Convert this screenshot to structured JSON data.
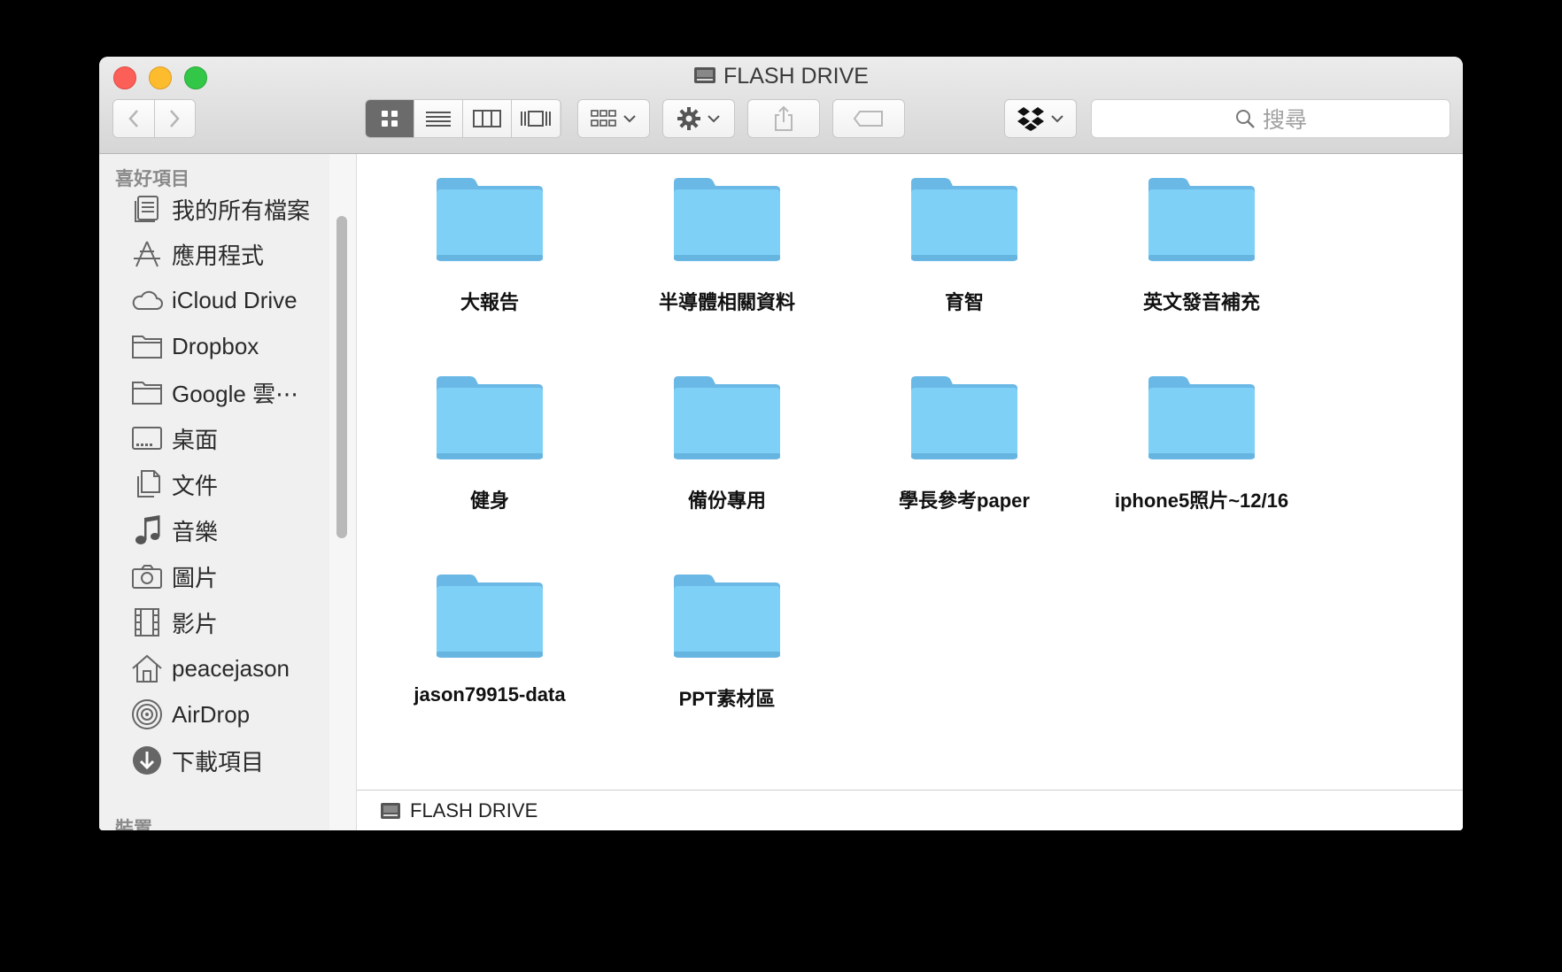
{
  "window": {
    "title": "FLASH DRIVE"
  },
  "toolbar": {
    "back_label": "‹",
    "forward_label": "›",
    "search_placeholder": "搜尋"
  },
  "sidebar": {
    "favorites_header": "喜好項目",
    "items": [
      {
        "label": "我的所有檔案",
        "icon": "all-files-icon"
      },
      {
        "label": "應用程式",
        "icon": "applications-icon"
      },
      {
        "label": "iCloud Drive",
        "icon": "cloud-icon"
      },
      {
        "label": "Dropbox",
        "icon": "folder-icon"
      },
      {
        "label": "Google 雲⋯",
        "icon": "folder-icon"
      },
      {
        "label": "桌面",
        "icon": "desktop-icon"
      },
      {
        "label": "文件",
        "icon": "documents-icon"
      },
      {
        "label": "音樂",
        "icon": "music-icon"
      },
      {
        "label": "圖片",
        "icon": "camera-icon"
      },
      {
        "label": "影片",
        "icon": "film-icon"
      },
      {
        "label": "peacejason",
        "icon": "home-icon"
      },
      {
        "label": "AirDrop",
        "icon": "airdrop-icon"
      },
      {
        "label": "下載項目",
        "icon": "download-icon"
      }
    ],
    "devices_header": "裝置"
  },
  "folders": [
    "大報告",
    "半導體相關資料",
    "育智",
    "英文發音補充",
    "健身",
    "備份專用",
    "學長參考paper",
    "iphone5照片~12/16",
    "jason79915-data",
    "PPT素材區"
  ],
  "pathbar": {
    "label": "FLASH DRIVE"
  },
  "colors": {
    "folder": "#79c9f2",
    "folder_tab": "#6ab8e6",
    "accent_active": "#6b6b6b"
  }
}
